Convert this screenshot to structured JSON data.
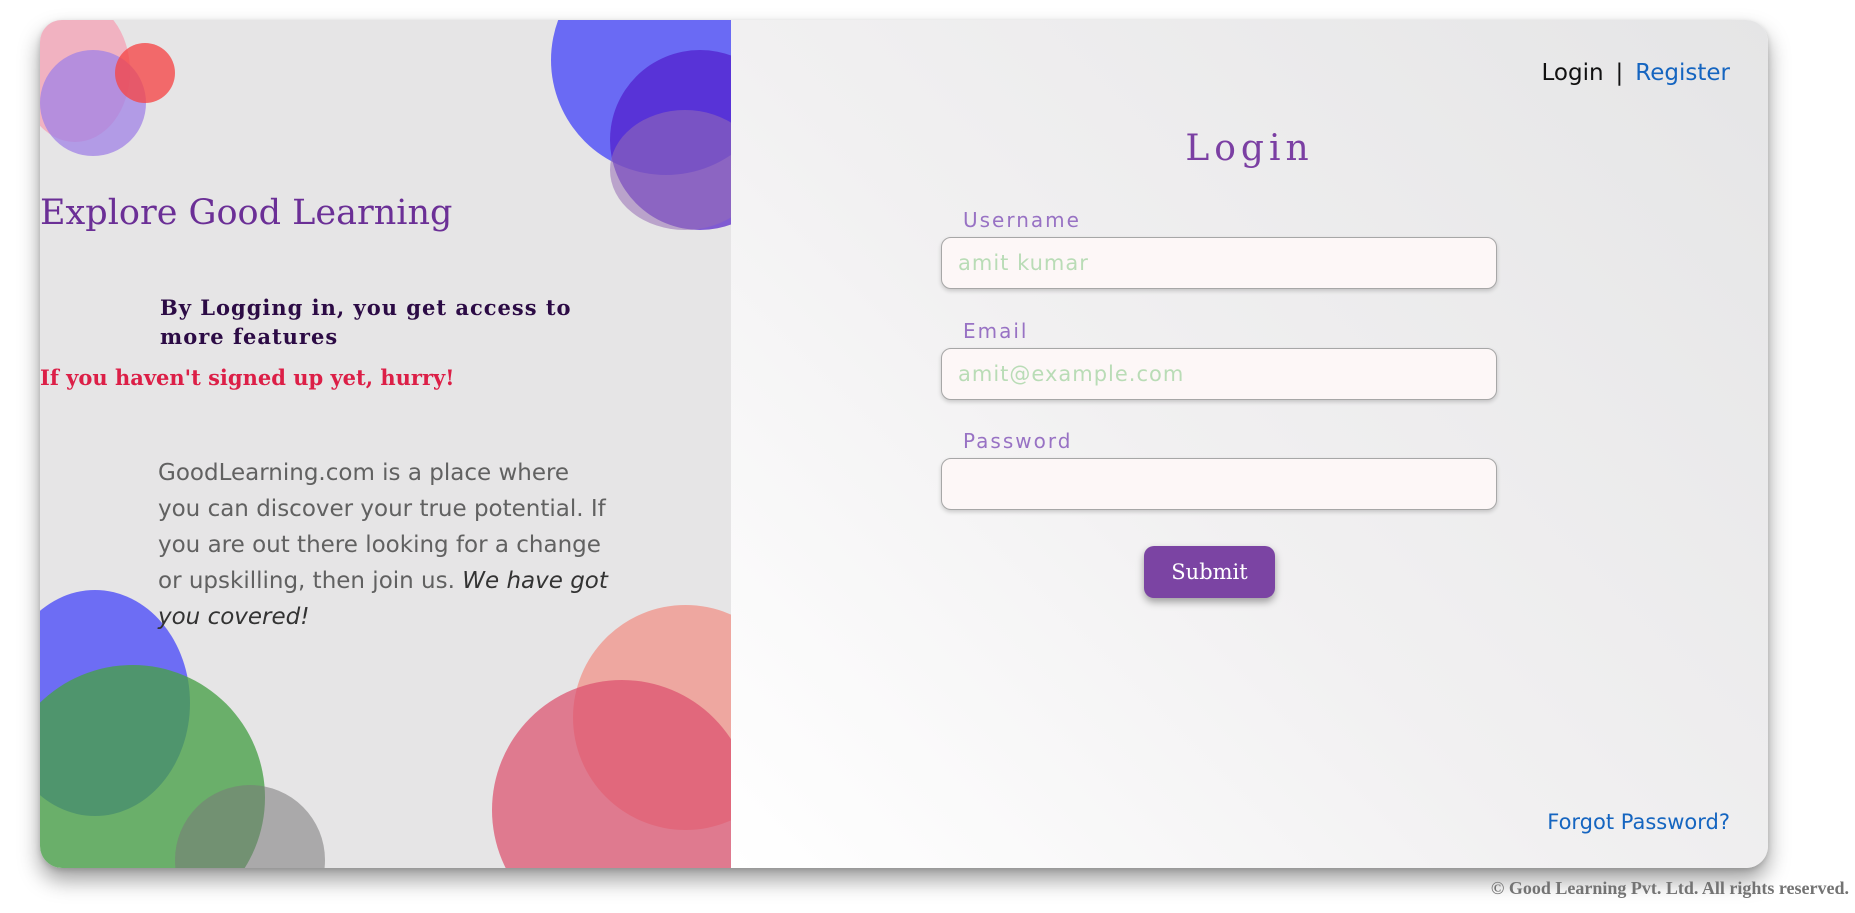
{
  "left_panel": {
    "title": "Explore Good Learning",
    "access_text": "By Logging in, you get access to more features",
    "hurry_text": "If you haven't signed up yet, hurry!",
    "about_text": "GoodLearning.com is a place where you can discover your true potential. If you are out there looking for a change or upskilling, then join us.",
    "about_emphasis": "We have got you covered!"
  },
  "nav": {
    "login": "Login",
    "separator": "|",
    "register": "Register"
  },
  "form": {
    "title": "Login",
    "username_label": "Username",
    "username_placeholder": "amit kumar",
    "email_label": "Email",
    "email_placeholder": "amit@example.com",
    "password_label": "Password",
    "password_placeholder": "",
    "submit_label": "Submit"
  },
  "forgot_password": "Forgot Password?",
  "footer": "© Good Learning Pvt. Ltd. All rights reserved.",
  "colors": {
    "brand_purple": "#7b44a3",
    "link_blue": "#1565c0",
    "hurry_red": "#dc1f47"
  }
}
